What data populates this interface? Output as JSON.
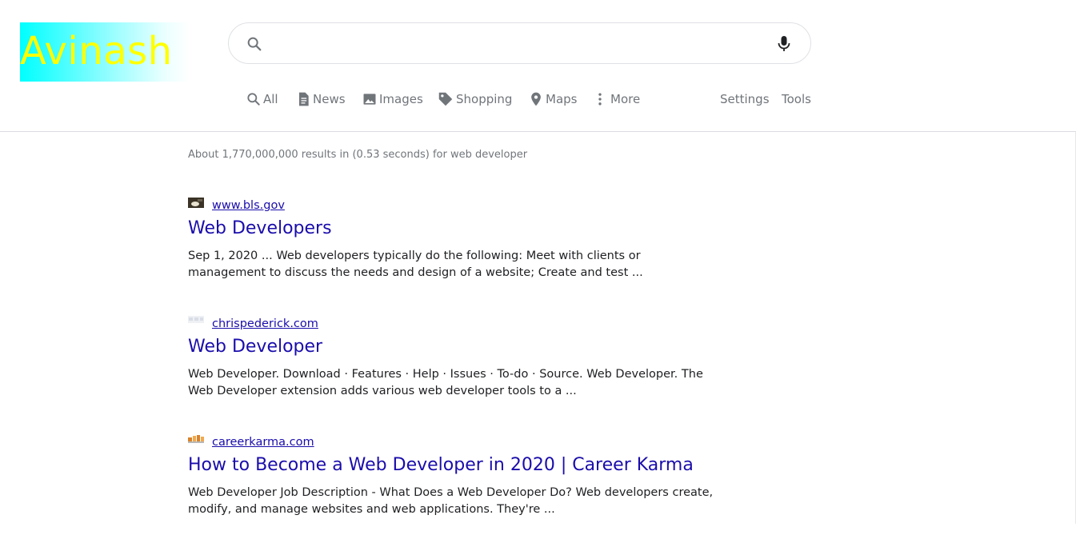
{
  "logo": {
    "text": "Avinash"
  },
  "search": {
    "value": "",
    "placeholder": ""
  },
  "tabs": [
    {
      "label": "All",
      "icon": "search-icon"
    },
    {
      "label": "News",
      "icon": "news-icon"
    },
    {
      "label": "Images",
      "icon": "image-icon"
    },
    {
      "label": "Shopping",
      "icon": "tag-icon"
    },
    {
      "label": "Maps",
      "icon": "map-pin-icon"
    },
    {
      "label": "More",
      "icon": "more-vertical-icon"
    }
  ],
  "tools": {
    "settings": "Settings",
    "tools": "Tools"
  },
  "stats": "About 1,770,000,000 results in (0.53 seconds) for web developer",
  "results": [
    {
      "site": "www.bls.gov",
      "title": "Web Developers",
      "snippet": "Sep 1, 2020 ... Web developers typically do the following: Meet with clients or management to discuss the needs and design of a website; Create and test ..."
    },
    {
      "site": "chrispederick.com",
      "title": "Web Developer",
      "snippet": "Web Developer. Download · Features · Help · Issues · To-do · Source. Web Developer. The Web Developer extension adds various web developer tools to a  ..."
    },
    {
      "site": "careerkarma.com",
      "title": "How to Become a Web Developer in 2020 | Career Karma",
      "snippet": "Web Developer Job Description - What Does a Web Developer Do? Web developers create, modify, and manage websites and web applications. They're ..."
    }
  ],
  "colors": {
    "link": "#1a0dab",
    "muted": "#70757a",
    "logo_text": "#ffff00",
    "logo_bg": "#00ffff"
  }
}
